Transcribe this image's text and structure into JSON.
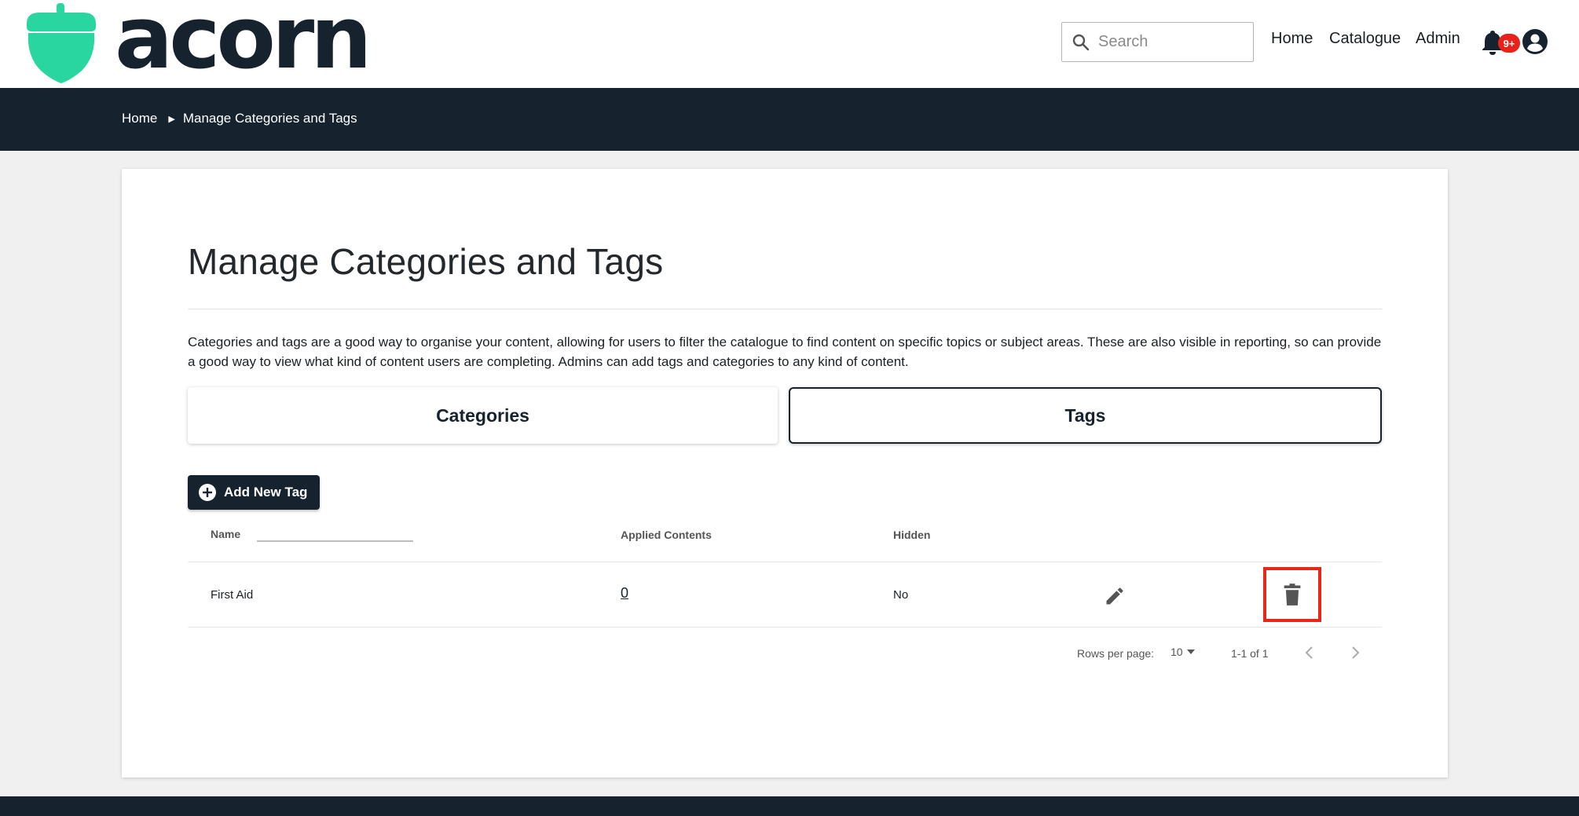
{
  "header": {
    "logo_text": "acorn",
    "search_placeholder": "Search",
    "nav": [
      "Home",
      "Catalogue",
      "Admin"
    ],
    "notification_badge": "9+"
  },
  "breadcrumb": {
    "home": "Home",
    "current": "Manage Categories and Tags"
  },
  "page": {
    "title": "Manage Categories and Tags",
    "description": "Categories and tags are a good way to organise your content, allowing for users to filter the catalogue to find content on specific topics or subject areas. These are also visible in reporting, so can provide a good way to view what kind of content users are completing. Admins can add tags and categories to any kind of content.",
    "tabs": [
      {
        "label": "Categories",
        "active": false
      },
      {
        "label": "Tags",
        "active": true
      }
    ],
    "add_button": "Add New Tag"
  },
  "table": {
    "columns": [
      "Name",
      "Applied Contents",
      "Hidden"
    ],
    "rows": [
      {
        "name": "First Aid",
        "applied_contents": "0",
        "hidden": "No"
      }
    ]
  },
  "pagination": {
    "rows_per_page_label": "Rows per page:",
    "rows_per_page_value": "10",
    "range": "1-1 of 1"
  },
  "colors": {
    "brand_dark": "#16232e",
    "brand_green": "#2ad6a0",
    "badge_red": "#e8221b",
    "highlight_red": "#e8271b"
  }
}
